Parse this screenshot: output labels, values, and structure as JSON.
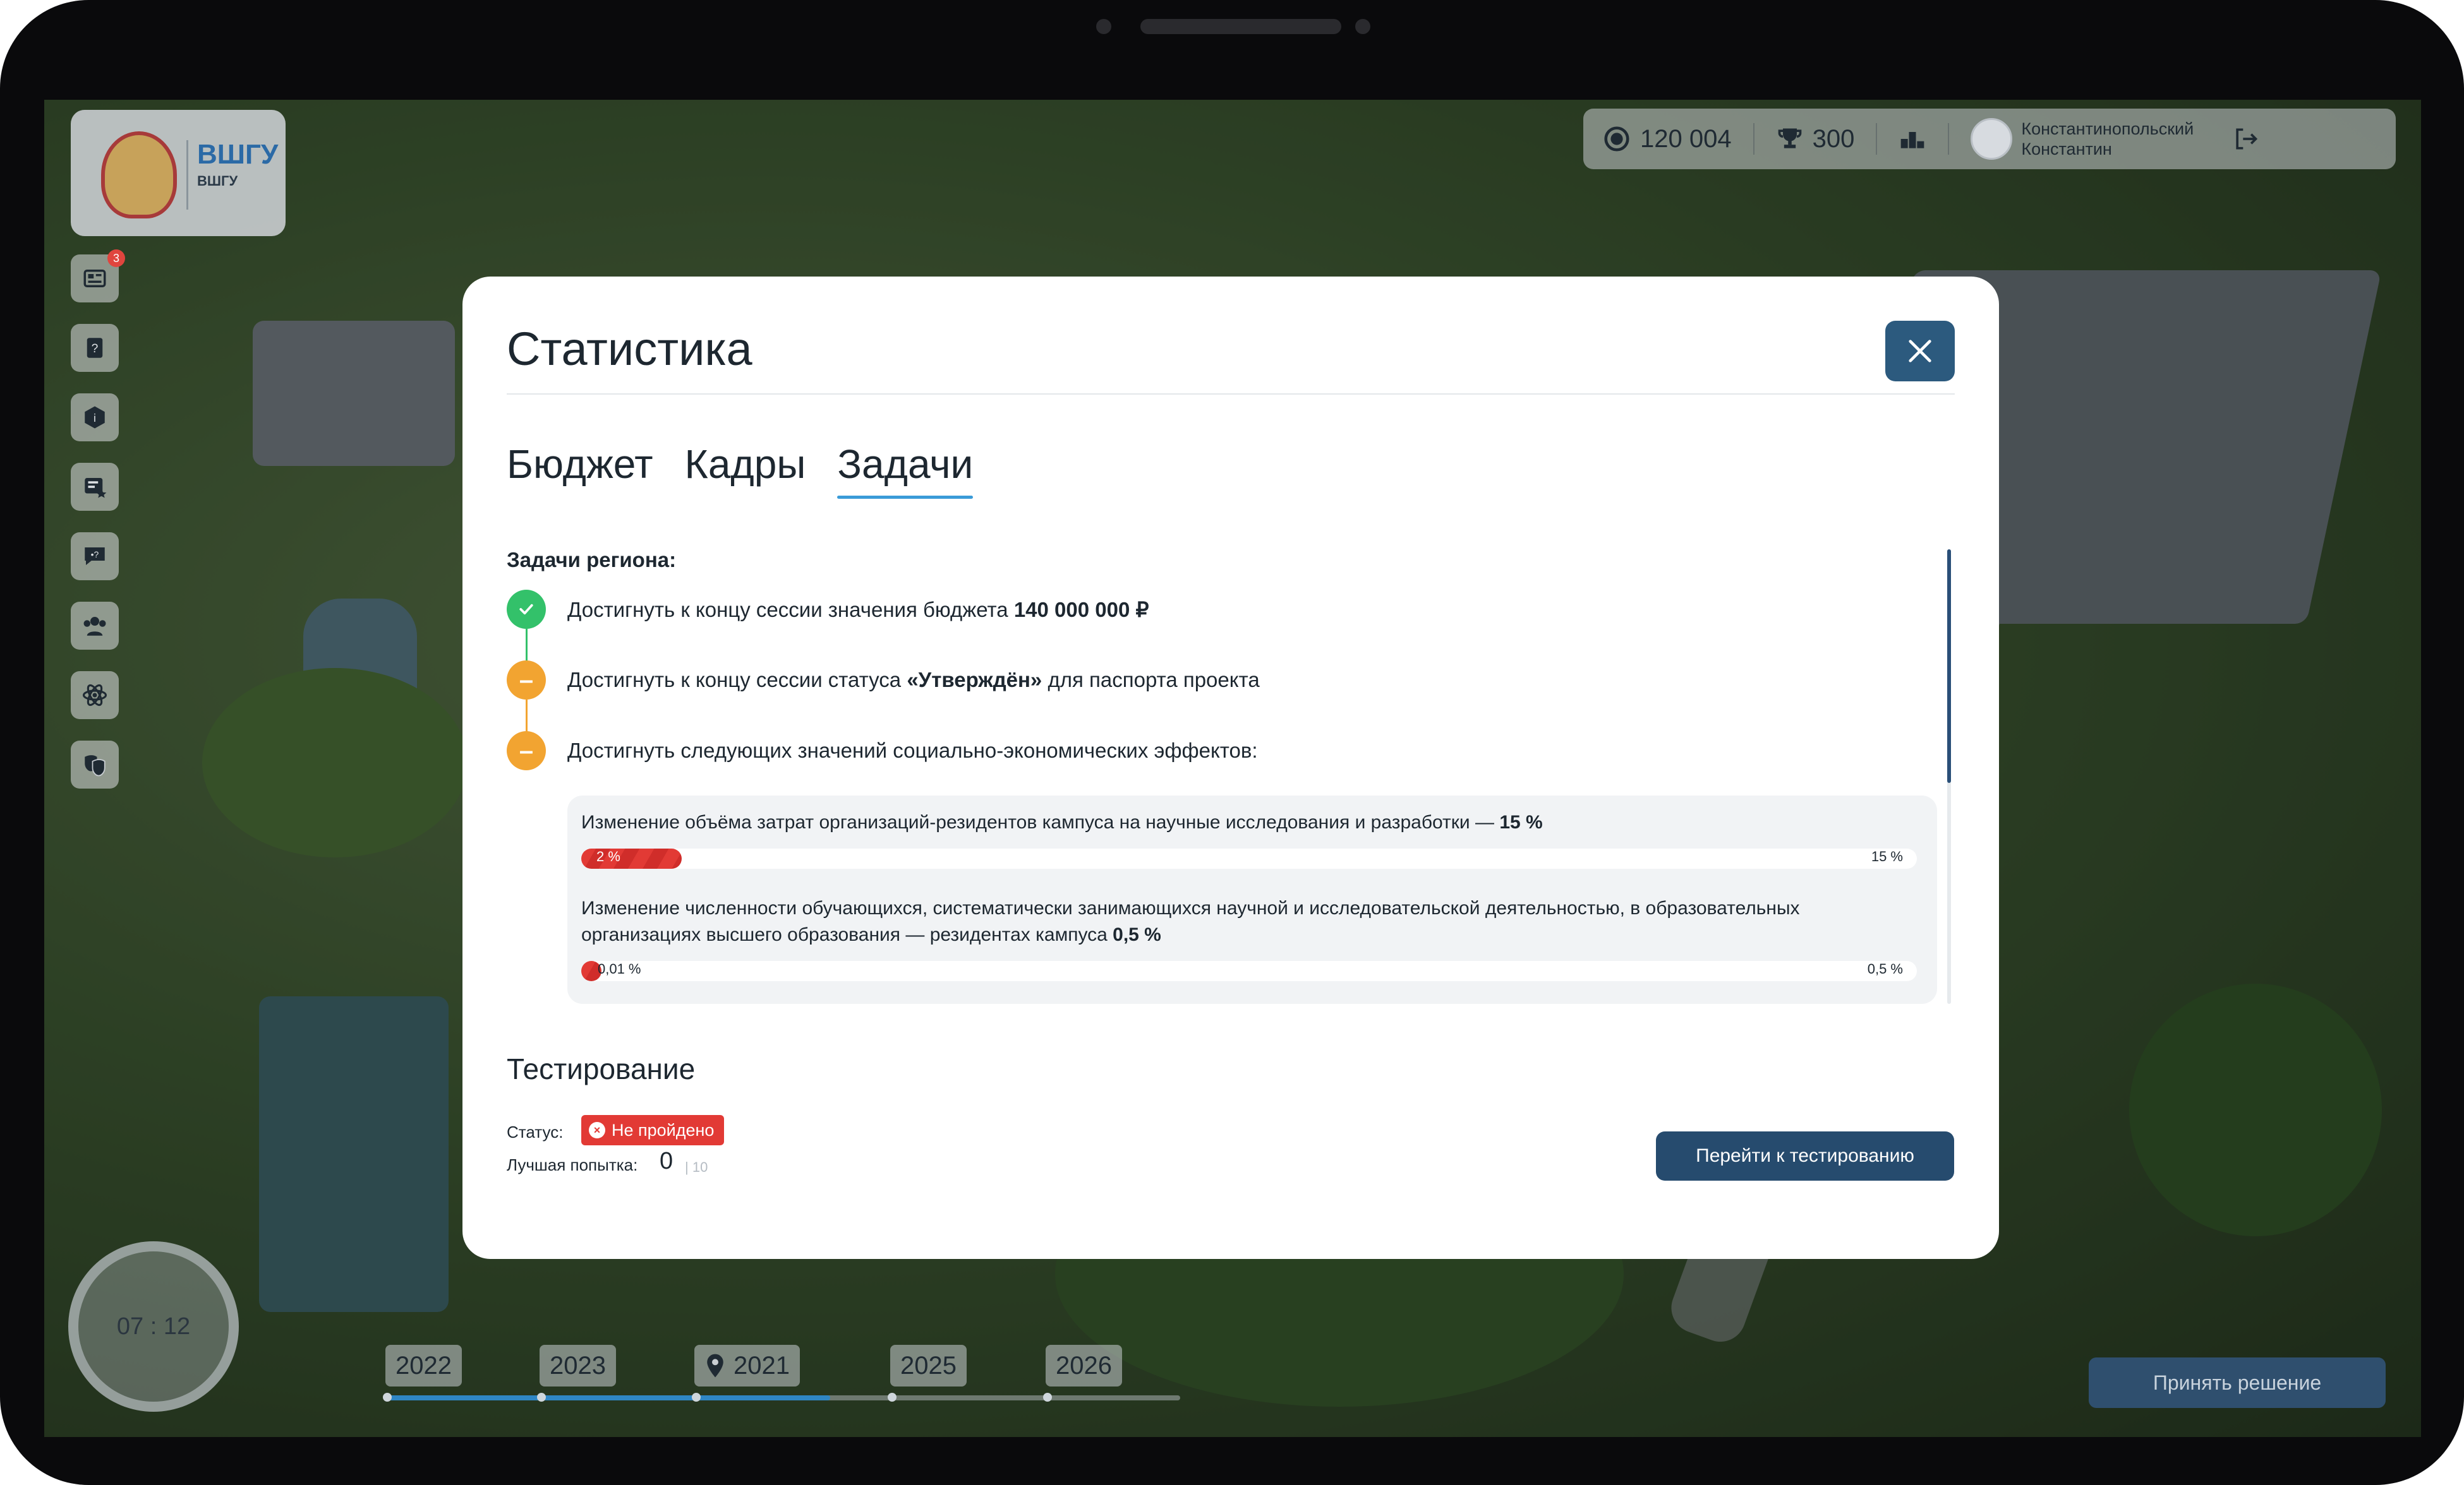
{
  "header": {
    "coins": "120 004",
    "trophies": "300",
    "user_name_line1": "Константинопольский",
    "user_name_line2": "Константин"
  },
  "logo": {
    "mark": "ВШГУ",
    "caption": "ВШГУ"
  },
  "sidebar": {
    "items": [
      {
        "icon": "news-icon",
        "badge": "3"
      },
      {
        "icon": "help-book-icon"
      },
      {
        "icon": "info-shield-icon"
      },
      {
        "icon": "rated-list-icon"
      },
      {
        "icon": "chat-icon"
      },
      {
        "icon": "team-icon"
      },
      {
        "icon": "atom-icon"
      },
      {
        "icon": "theater-masks-icon"
      }
    ]
  },
  "timer": "07 : 12",
  "timeline": {
    "years": [
      "2022",
      "2023",
      "2021",
      "2025",
      "2026"
    ],
    "current_index": 2,
    "progress": 0.56
  },
  "decide_button": "Принять решение",
  "modal": {
    "title": "Статистика",
    "tabs": [
      "Бюджет",
      "Кадры",
      "Задачи"
    ],
    "active_tab": "Задачи",
    "tasks_label": "Задачи региона:",
    "tasks": [
      {
        "status": "done",
        "text": "Достигнуть к концу сессии значения бюджета ",
        "bold": "140 000 000 ₽",
        "after": ""
      },
      {
        "status": "pending",
        "text": "Достигнуть к концу сессии статуса ",
        "bold": "«Утверждён»",
        "after": " для паспорта проекта"
      },
      {
        "status": "pending",
        "text": "Достигнуть следующих значений социально-экономических эффектов:",
        "bold": "",
        "after": ""
      }
    ],
    "effects": [
      {
        "text": "Изменение объёма затрат организаций-резидентов кампуса на научные исследования и разработки  —  ",
        "target_bold": "15 %",
        "current_label": "2 %",
        "target_label": "15 %",
        "progress": 0.075
      },
      {
        "text": "Изменение численности обучающихся, систематически занимающихся научной и исследовательской деятельностью, в образовательных организациях высшего образования — резидентах кампуса ",
        "target_bold": "0,5 %",
        "current_label": "0,01 %",
        "target_label": "0,5 %",
        "progress": 0.01
      }
    ],
    "testing": {
      "title": "Тестирование",
      "status_label": "Статус:",
      "status_value": "Не пройдено",
      "best_label": "Лучшая попытка:",
      "best_score": "0",
      "best_max": "| 10",
      "go_button": "Перейти к тестированию"
    }
  },
  "colors": {
    "accent": "#3a9bd8",
    "primary_button": "#264b6e",
    "success": "#33c16a",
    "warning": "#f2a431",
    "danger": "#e23a35"
  }
}
